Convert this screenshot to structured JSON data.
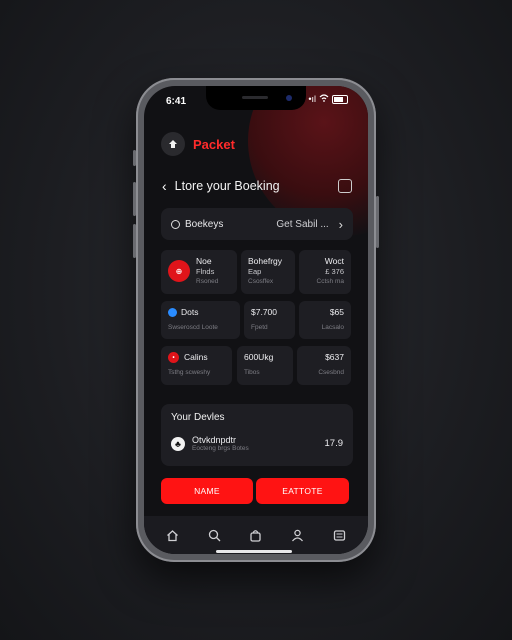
{
  "status": {
    "time": "6:41",
    "network": "•ıl"
  },
  "brand": {
    "name": "Packet"
  },
  "header": {
    "title": "Ltore your Boeking"
  },
  "search": {
    "label": "Boekeys",
    "right": "Get Sabil ..."
  },
  "cards": {
    "r1c1": {
      "title": "Noe",
      "sub": "Flnds",
      "meta": "Rsoned"
    },
    "r1c2": {
      "title": "Bohefrgy",
      "sub": "Eap",
      "meta": "Csosffex"
    },
    "r1c3": {
      "title": "Woct",
      "sub": "£ 376",
      "meta": "Cctsh ma"
    },
    "r2c1": {
      "title": "Dots",
      "meta": "Swseroscd Loote"
    },
    "r2c2": {
      "title": "$7.700",
      "meta": "Fpetd"
    },
    "r2c3": {
      "title": "$65",
      "meta": "Lacsalo"
    },
    "r3c1": {
      "title": "Calins",
      "meta": "Tsthg scweshy"
    },
    "r3c2": {
      "title": "600Ukg",
      "meta": "Tibos"
    },
    "r3c3": {
      "title": "$637",
      "meta": "Csesbnd"
    }
  },
  "devices": {
    "title": "Your Devles",
    "item_name": "Otvkdnpdtr",
    "item_sub": "Eocteng brgs Botes",
    "item_value": "17.9"
  },
  "buttons": {
    "left": "NAME",
    "right": "EATTOTE"
  },
  "colors": {
    "accent": "#ff1313",
    "brand": "#ff2b2b",
    "surface": "#1e1e23"
  },
  "tabbar": {
    "icons": [
      "home-icon",
      "search-icon",
      "bag-icon",
      "profile-icon",
      "menu-icon"
    ]
  }
}
